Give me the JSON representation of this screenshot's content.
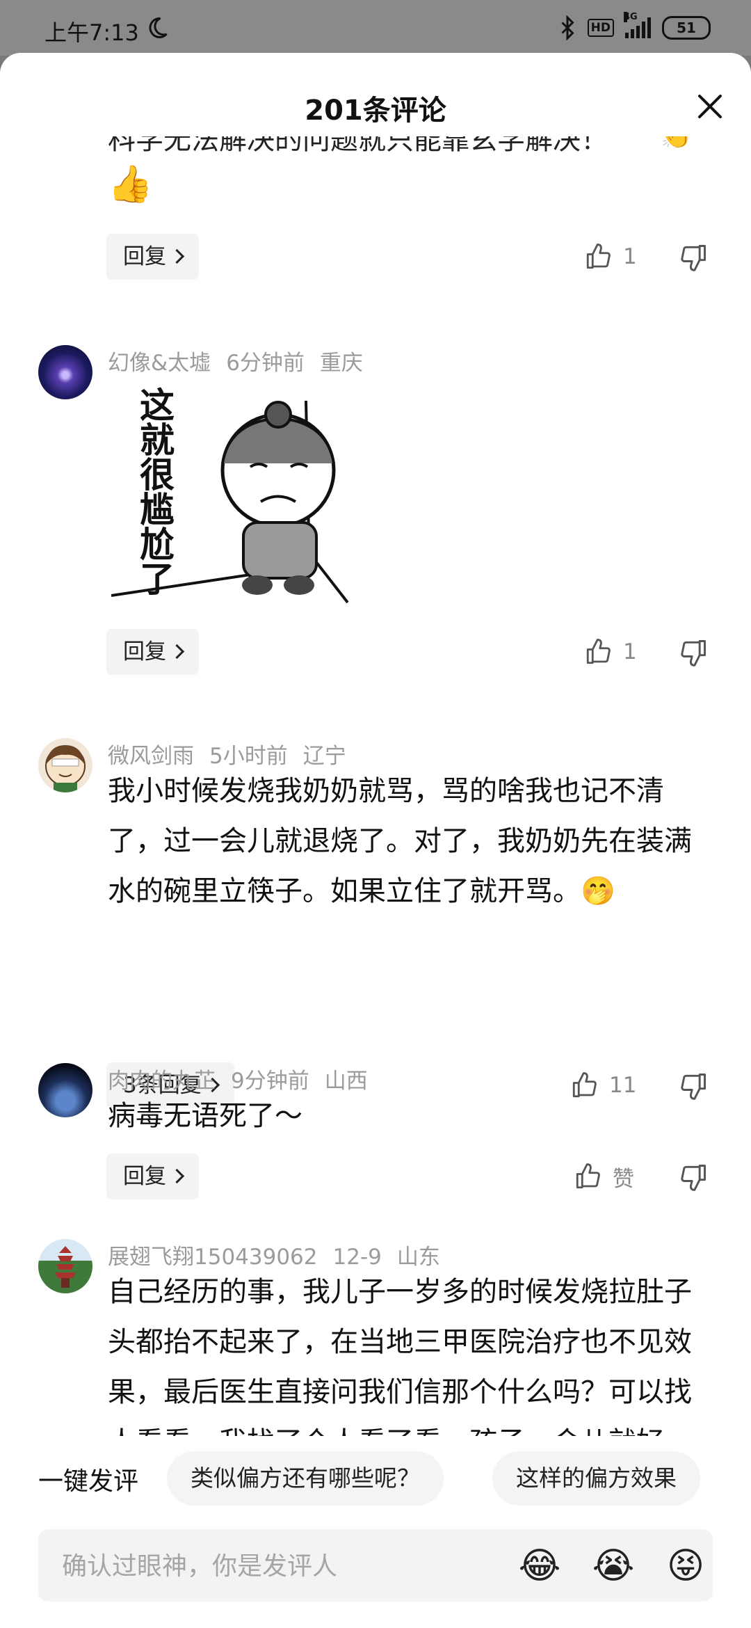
{
  "status_bar": {
    "time": "上午7:13",
    "hd": "HD",
    "network": "4G",
    "battery": "51"
  },
  "sheet": {
    "title": "201条评论"
  },
  "partial_comment": {
    "text_fragment": "科学无法解决的问题就只能靠玄学解决！",
    "emoji": "👏",
    "thumb_emoji": "👍",
    "reply_label": "回复",
    "likes": "1"
  },
  "comments": [
    {
      "user": "幻像&太墟",
      "time": "6分钟前",
      "location": "重庆",
      "meme_text": "这就很尴尬了",
      "reply_label": "回复",
      "likes": "1"
    },
    {
      "user": "微风剑雨",
      "time": "5小时前",
      "location": "辽宁",
      "text": "我小时候发烧我奶奶就骂，骂的啥我也记不清了，过一会儿就退烧了。对了，我奶奶先在装满水的碗里立筷子。如果立住了就开骂。🤭",
      "reply_label": "3条回复",
      "likes": "11"
    },
    {
      "user": "肉肉的丸芷",
      "time": "9分钟前",
      "location": "山西",
      "text": "病毒无语死了～",
      "reply_label": "回复",
      "likes": "赞"
    },
    {
      "user": "展翅飞翔150439062",
      "time": "12-9",
      "location": "山东",
      "text": "自己经历的事，我儿子一岁多的时候发烧拉肚子头都抬不起来了，在当地三甲医院治疗也不见效果，最后医生直接问我们信那个什么吗？可以找人看看，我找了个人看了看，孩子一会儿就好了。"
    }
  ],
  "quick_reply": {
    "label": "一键发评",
    "chips": [
      "类似偏方还有哪些呢？",
      "这样的偏方效果"
    ]
  },
  "input": {
    "placeholder": "确认过眼神，你是发评人"
  },
  "emoji_buttons": [
    "😂",
    "😭",
    "😝"
  ],
  "colors": {
    "accent_text": "#111111",
    "meta_text": "#9b9b9b",
    "chip_bg": "#f4f4f4",
    "dim_overlay": "#7a7a7a"
  }
}
